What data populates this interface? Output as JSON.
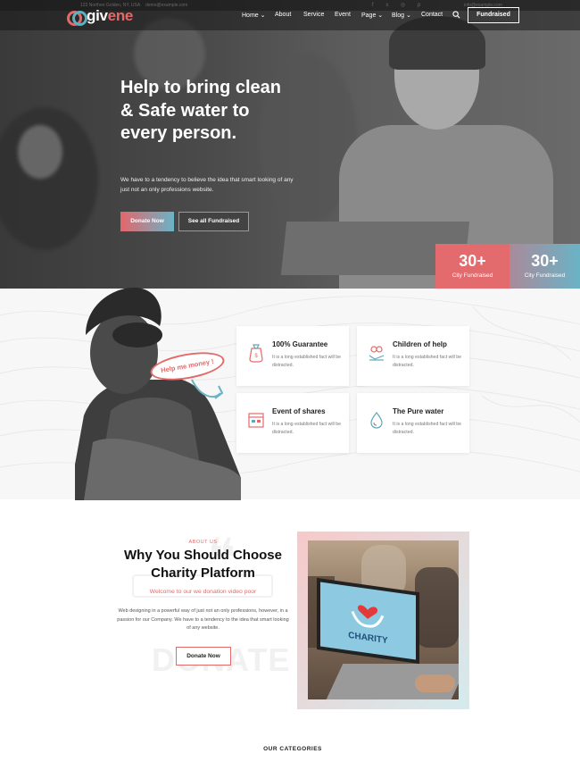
{
  "topbar": {
    "address": "123 Northen Golden, NY, USA",
    "email": "demo@example.com",
    "social": "f  x  ◎  p",
    "right_text": "info@example.com"
  },
  "header": {
    "logo_text_main": "giv",
    "logo_text_accent": "ene",
    "nav": [
      "Home",
      "About",
      "Service",
      "Event",
      "Page",
      "Blog",
      "Contact"
    ],
    "fund_button": "Fundraised"
  },
  "hero": {
    "title": "Help to bring clean & Safe water to every person.",
    "subtitle": "We have to a tendency to believe the idea that smart looking of any just not an only professions website.",
    "donate_button": "Donate Now",
    "see_all_button": "See all Fundraised",
    "stats": [
      {
        "num": "30+",
        "label": "City Fundraised",
        "color": "#e36a6d"
      },
      {
        "num": "30+",
        "label": "City Fundraised",
        "color": "#6ab3c6"
      }
    ]
  },
  "services": {
    "bubble_text": "Help me money !",
    "cards": [
      {
        "title": "100% Guarantee",
        "desc": "It is a long established fact will be distracted.",
        "icon": "money-bag-icon"
      },
      {
        "title": "Children of help",
        "desc": "It is a long established fact will be distracted.",
        "icon": "heart-hands-icon"
      },
      {
        "title": "Event of shares",
        "desc": "It is a long established fact will be distracted.",
        "icon": "calendar-icon"
      },
      {
        "title": "The Pure water",
        "desc": "It is a long established fact will be distracted.",
        "icon": "water-drop-icon"
      }
    ]
  },
  "about": {
    "label": "ABOUT US",
    "title": "Why You Should Choose Charity Platform",
    "subtitle": "Welcome to our we donation video poor",
    "text": "Web designing in a powerful way of just not an only professions, however, in a passion for our Company. We have to a tendency to the idea that smart looking of any website.",
    "bg_word": "DONATE",
    "button": "Donate Now",
    "laptop_text": "CHARITY"
  },
  "categories": {
    "title": "OUR CATEGORIES"
  },
  "colors": {
    "accent_red": "#e46a6a",
    "accent_teal": "#6ab3c6"
  }
}
